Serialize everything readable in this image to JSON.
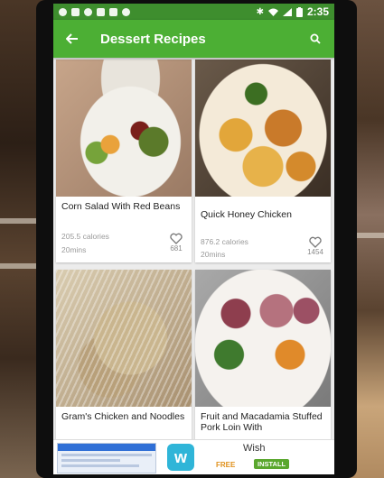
{
  "status_bar": {
    "time": "2:35",
    "left_icons": [
      "shield-icon",
      "image-icon",
      "sync-icon",
      "wrench-icon",
      "lock-icon",
      "android-icon"
    ],
    "right_icons": [
      "bluetooth-icon",
      "wifi-icon",
      "signal-icon",
      "battery-icon"
    ]
  },
  "app_bar": {
    "title": "Dessert Recipes",
    "back_icon": "arrow-left-icon",
    "search_icon": "search-icon",
    "color": "#4caf34",
    "status_color": "#3e8e2e"
  },
  "recipes": [
    {
      "name": "Corn Salad With Red Beans",
      "calories": "205.5 calories",
      "time": "20mins",
      "favorites": "681",
      "image": "corn-salad-photo"
    },
    {
      "name": "Quick Honey Chicken",
      "calories": "876.2 calories",
      "time": "20mins",
      "favorites": "1454",
      "image": "honey-chicken-photo"
    },
    {
      "name": "Gram's Chicken and Noodles",
      "image": "chicken-noodles-photo"
    },
    {
      "name": "Fruit and Macadamia Stuffed Pork Loin With",
      "image": "pork-loin-photo"
    }
  ],
  "ad": {
    "app_name": "Wish",
    "logo_text": "w",
    "price": "FREE",
    "install_label": "INSTALL"
  }
}
